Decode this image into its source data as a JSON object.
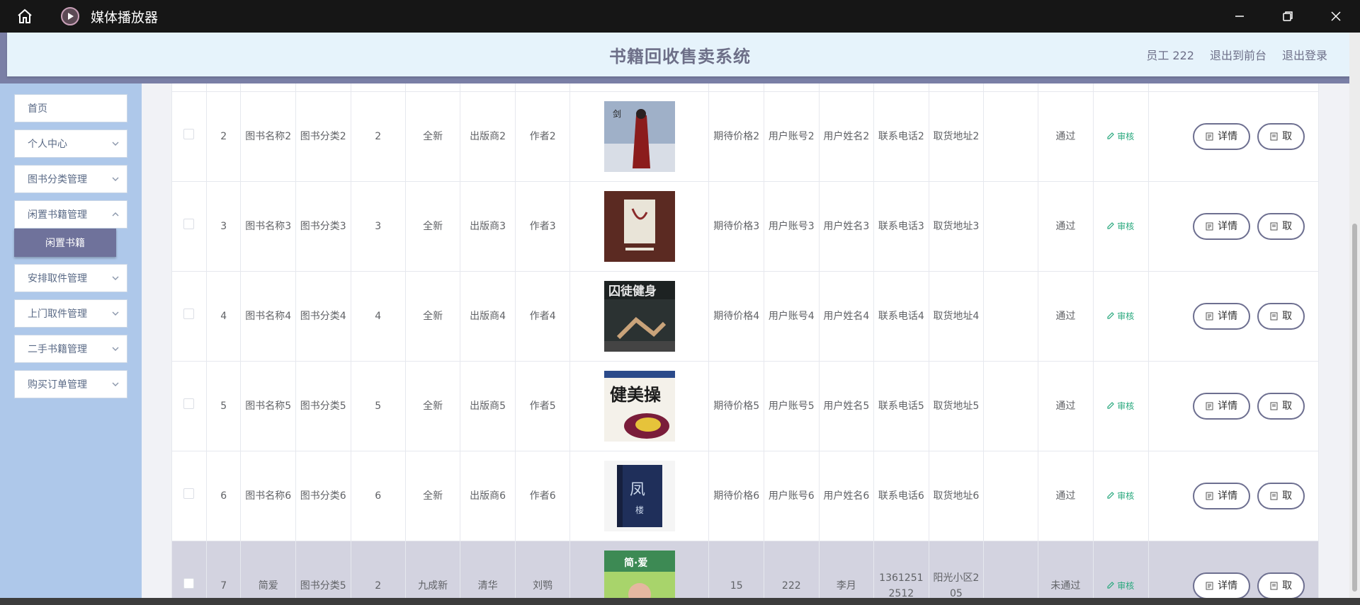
{
  "window": {
    "title": "媒体播放器"
  },
  "header": {
    "site_title": "书籍回收售卖系统",
    "user": "员工 222",
    "to_front": "退出到前台",
    "logout": "退出登录"
  },
  "sidebar": {
    "items": [
      {
        "label": "首页"
      },
      {
        "label": "个人中心"
      },
      {
        "label": "图书分类管理"
      },
      {
        "label": "闲置书籍管理"
      },
      {
        "label": "安排取件管理"
      },
      {
        "label": "上门取件管理"
      },
      {
        "label": "二手书籍管理"
      },
      {
        "label": "购买订单管理"
      }
    ],
    "active_sub": "闲置书籍"
  },
  "table": {
    "audit_label": "审核",
    "detail_label": "详情",
    "second_btn_label": "取",
    "rows": [
      {
        "idx": "2",
        "name": "图书名称2",
        "category": "图书分类2",
        "qty": "2",
        "condition": "全新",
        "publisher": "出版商2",
        "author": "作者2",
        "price": "期待价格2",
        "account": "用户账号2",
        "username": "用户姓名2",
        "phone": "联系电话2",
        "address": "取货地址2",
        "status": "通过"
      },
      {
        "idx": "3",
        "name": "图书名称3",
        "category": "图书分类3",
        "qty": "3",
        "condition": "全新",
        "publisher": "出版商3",
        "author": "作者3",
        "price": "期待价格3",
        "account": "用户账号3",
        "username": "用户姓名3",
        "phone": "联系电话3",
        "address": "取货地址3",
        "status": "通过"
      },
      {
        "idx": "4",
        "name": "图书名称4",
        "category": "图书分类4",
        "qty": "4",
        "condition": "全新",
        "publisher": "出版商4",
        "author": "作者4",
        "price": "期待价格4",
        "account": "用户账号4",
        "username": "用户姓名4",
        "phone": "联系电话4",
        "address": "取货地址4",
        "status": "通过"
      },
      {
        "idx": "5",
        "name": "图书名称5",
        "category": "图书分类5",
        "qty": "5",
        "condition": "全新",
        "publisher": "出版商5",
        "author": "作者5",
        "price": "期待价格5",
        "account": "用户账号5",
        "username": "用户姓名5",
        "phone": "联系电话5",
        "address": "取货地址5",
        "status": "通过"
      },
      {
        "idx": "6",
        "name": "图书名称6",
        "category": "图书分类6",
        "qty": "6",
        "condition": "全新",
        "publisher": "出版商6",
        "author": "作者6",
        "price": "期待价格6",
        "account": "用户账号6",
        "username": "用户姓名6",
        "phone": "联系电话6",
        "address": "取货地址6",
        "status": "通过"
      },
      {
        "idx": "7",
        "name": "简爱",
        "category": "图书分类5",
        "qty": "2",
        "condition": "九成新",
        "publisher": "清华",
        "author": "刘鹗",
        "price": "15",
        "account": "222",
        "username": "李月",
        "phone": "13612512512",
        "address": "阳光小区205",
        "status": "未通过"
      }
    ]
  },
  "colors": {
    "accent": "#6f729b",
    "header_bg": "#e6f3fb",
    "sidebar_bg": "#aec8ea",
    "audit_green": "#28a87d",
    "highlight_row": "#d3d3e0"
  }
}
